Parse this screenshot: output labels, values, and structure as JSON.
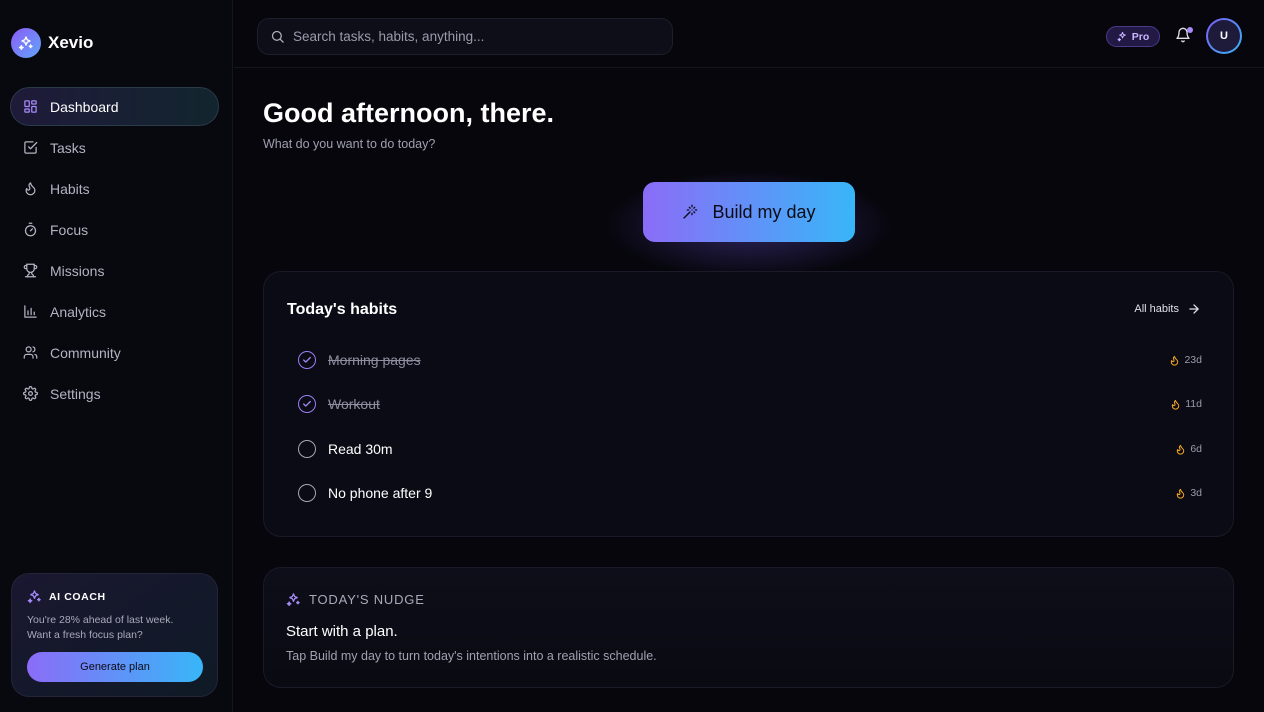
{
  "brand": {
    "name": "Xevio"
  },
  "sidebar": {
    "items": [
      {
        "label": "Dashboard",
        "icon": "dashboard-icon",
        "active": true
      },
      {
        "label": "Tasks",
        "icon": "tasks-icon"
      },
      {
        "label": "Habits",
        "icon": "flame-icon"
      },
      {
        "label": "Focus",
        "icon": "timer-icon"
      },
      {
        "label": "Missions",
        "icon": "trophy-icon"
      },
      {
        "label": "Analytics",
        "icon": "chart-icon"
      },
      {
        "label": "Community",
        "icon": "users-icon"
      },
      {
        "label": "Settings",
        "icon": "gear-icon"
      }
    ],
    "coach": {
      "title": "AI COACH",
      "line1": "You're 28% ahead of last week.",
      "line2": "Want a fresh focus plan?",
      "button": "Generate plan"
    }
  },
  "header": {
    "search_placeholder": "Search tasks, habits, anything...",
    "badge": "Pro",
    "avatar_initial": "U"
  },
  "main": {
    "greeting": "Good afternoon, there.",
    "subtitle": "What do you want to do today?",
    "build_button": "Build my day"
  },
  "habits": {
    "title": "Today's habits",
    "link": "All habits",
    "items": [
      {
        "label": "Morning pages",
        "done": true,
        "streak": "23d"
      },
      {
        "label": "Workout",
        "done": true,
        "streak": "11d"
      },
      {
        "label": "Read 30m",
        "done": false,
        "streak": "6d"
      },
      {
        "label": "No phone after 9",
        "done": false,
        "streak": "3d"
      }
    ]
  },
  "nudge": {
    "heading": "TODAY'S NUDGE",
    "title": "Start with a plan.",
    "body": "Tap Build my day to turn today's intentions into a realistic schedule."
  },
  "colors": {
    "accent_purple": "#8b6cf7",
    "accent_blue": "#38b6f8",
    "streak_orange": "#f5a524",
    "background": "#06060c"
  }
}
